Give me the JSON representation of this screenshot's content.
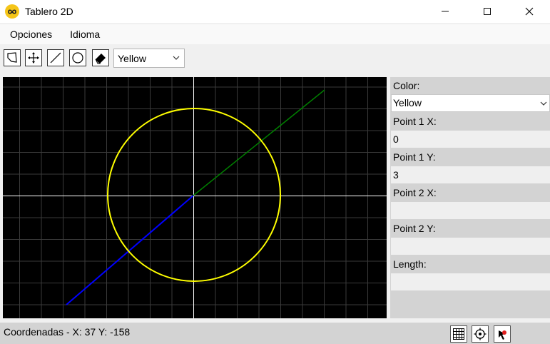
{
  "window": {
    "title": "Tablero 2D"
  },
  "menu": {
    "items": [
      "Opciones",
      "Idioma"
    ]
  },
  "toolbar": {
    "tools": [
      "polygon-tool",
      "move-tool",
      "line-tool",
      "circle-tool",
      "eraser-tool"
    ],
    "color_selected": "Yellow"
  },
  "panel": {
    "color_label": "Color:",
    "color_value": "Yellow",
    "point1x_label": "Point 1 X:",
    "point1x_value": "0",
    "point1y_label": "Point 1 Y:",
    "point1y_value": "3",
    "point2x_label": "Point 2 X:",
    "point2x_value": "",
    "point2y_label": "Point 2 Y:",
    "point2y_value": "",
    "length_label": "Length:",
    "length_value": ""
  },
  "status": {
    "coords": "Coordenadas - X: 37 Y: -158"
  },
  "colors": {
    "canvas_bg": "#000000",
    "grid": "#3a3a3a",
    "axes": "#ffffff",
    "circle": "#ffff00",
    "line_blue": "#0000ff",
    "line_green": "#008000"
  }
}
